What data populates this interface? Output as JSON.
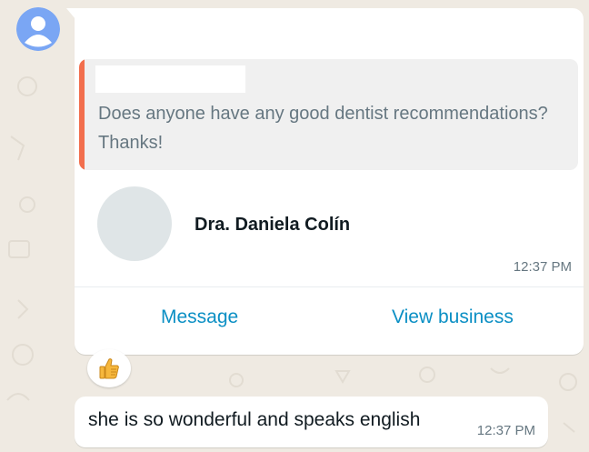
{
  "chat": {
    "business_card": {
      "quoted_message": {
        "author": "",
        "text": "Does anyone have any good dentist recommendations? Thanks!"
      },
      "contact_name": "Dra. Daniela Colín",
      "timestamp": "12:37 PM",
      "actions": {
        "message_label": "Message",
        "view_business_label": "View business"
      },
      "reaction": "thumbs-up"
    },
    "text_message": {
      "text": "she is so wonderful and speaks english",
      "timestamp": "12:37 PM"
    }
  },
  "colors": {
    "chat_background": "#efeae2",
    "quote_accent": "#f26e4d",
    "action_link": "#0b8fc4",
    "avatar_blue": "#7aa6f4"
  }
}
